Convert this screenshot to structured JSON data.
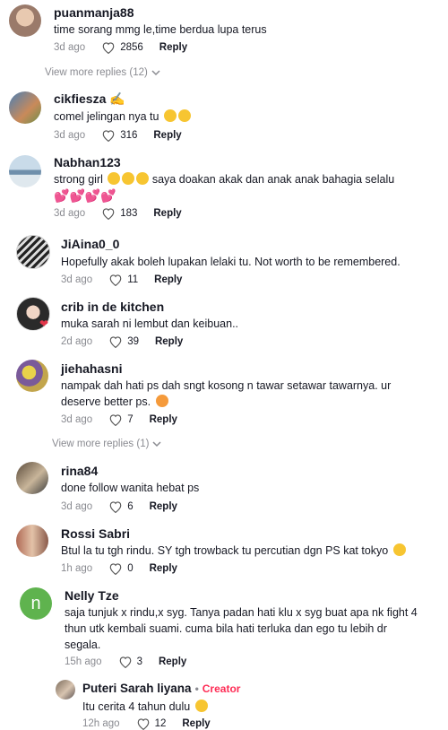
{
  "comments": [
    {
      "username": "puanmanja88",
      "text": "time sorang mmg le,time berdua lupa terus",
      "time": "3d ago",
      "likes": "2856",
      "reply": "Reply",
      "view_more": "View more replies (12)"
    },
    {
      "username": "cikfiesza",
      "text": "comel jelingan nya tu",
      "time": "3d ago",
      "likes": "316",
      "reply": "Reply"
    },
    {
      "username": "Nabhan123",
      "text": "strong girl",
      "text2": "saya doakan akak dan anak anak bahagia selalu",
      "time": "3d ago",
      "likes": "183",
      "reply": "Reply"
    },
    {
      "username": "JiAina0_0",
      "text": "Hopefully akak boleh lupakan lelaki tu. Not worth to be remembered.",
      "time": "3d ago",
      "likes": "11",
      "reply": "Reply"
    },
    {
      "username": "crib in de kitchen",
      "text": "muka sarah ni lembut dan keibuan..",
      "time": "2d ago",
      "likes": "39",
      "reply": "Reply"
    },
    {
      "username": "jiehahasni",
      "text": "nampak dah hati ps dah sngt kosong n tawar setawar tawarnya. ur",
      "text2": "deserve better ps.",
      "time": "3d ago",
      "likes": "7",
      "reply": "Reply",
      "view_more": "View more replies (1)"
    },
    {
      "username": "rina84",
      "text": "done follow wanita hebat ps",
      "time": "3d ago",
      "likes": "6",
      "reply": "Reply"
    },
    {
      "username": "Rossi Sabri",
      "text": "Btul la tu tgh rindu. SY tgh trowback tu percutian dgn PS kat tokyo",
      "time": "1h ago",
      "likes": "0",
      "reply": "Reply"
    },
    {
      "username": "Nelly Tze",
      "avatar_letter": "n",
      "text": "saja tunjuk x rindu,x syg. Tanya padan hati klu x syg buat apa nk fight 4",
      "text2": "thun utk kembali suami. cuma bila hati terluka dan ego tu lebih dr",
      "text3": "segala.",
      "time": "15h ago",
      "likes": "3",
      "reply": "Reply"
    },
    {
      "username": "Puteri Sarah liyana",
      "creator_badge": "Creator",
      "text": "Itu cerita 4 tahun dulu",
      "time": "12h ago",
      "likes": "12",
      "reply": "Reply"
    }
  ],
  "colors": {
    "creator": "#fe2c55",
    "meta": "#8a8b91",
    "avatar_green": "#5fb34e"
  }
}
